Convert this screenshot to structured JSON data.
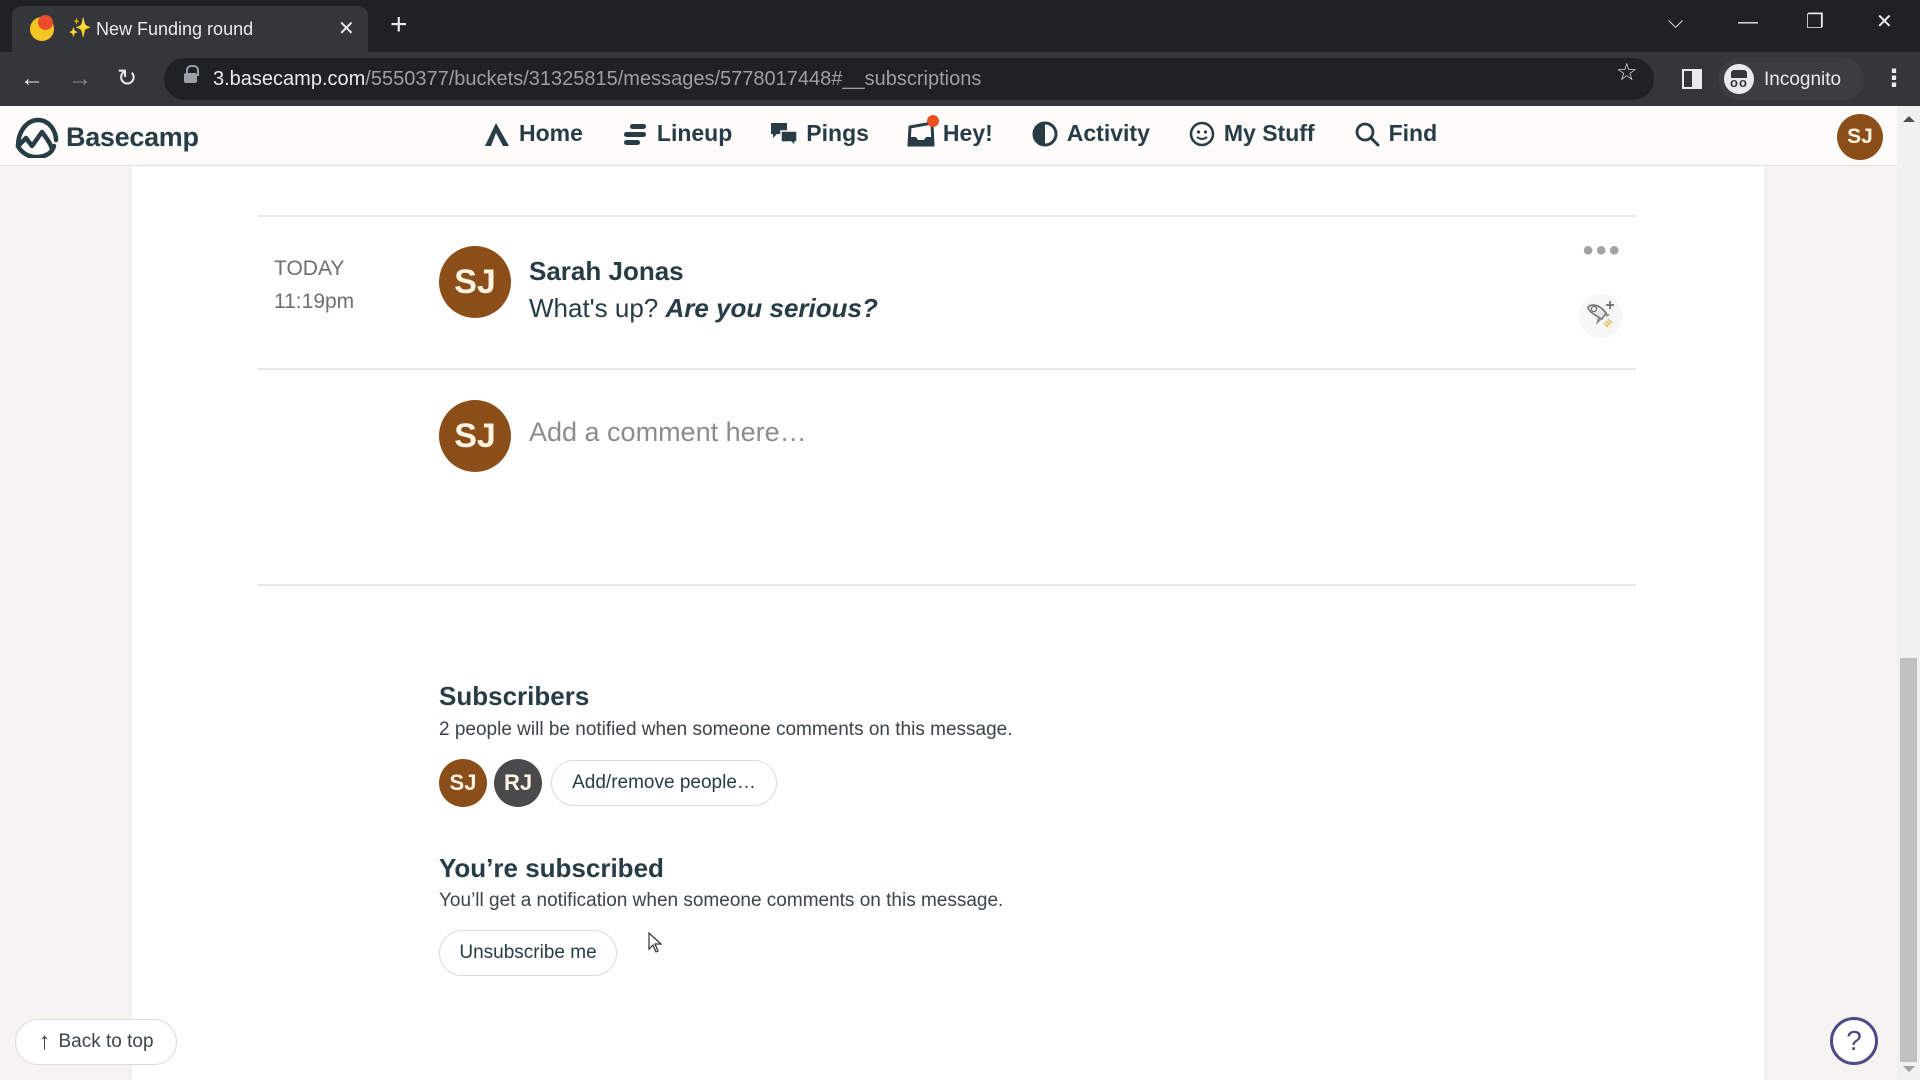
{
  "browser": {
    "tab": {
      "title": "New Funding round",
      "emoji": "✨"
    },
    "url": {
      "host": "3.basecamp.com",
      "path": "/5550377/buckets/31325815/messages/5778017448#__subscriptions"
    },
    "profile_label": "Incognito"
  },
  "app": {
    "brand": "Basecamp",
    "nav": [
      {
        "label": "Home",
        "icon": "home-icon"
      },
      {
        "label": "Lineup",
        "icon": "lineup-icon"
      },
      {
        "label": "Pings",
        "icon": "pings-icon"
      },
      {
        "label": "Hey!",
        "icon": "hey-inbox-icon",
        "has_notification": true
      },
      {
        "label": "Activity",
        "icon": "activity-icon"
      },
      {
        "label": "My Stuff",
        "icon": "smiley-icon"
      },
      {
        "label": "Find",
        "icon": "search-icon"
      }
    ],
    "user_initials": "SJ"
  },
  "comment": {
    "day": "TODAY",
    "time": "11:19pm",
    "author_initials": "SJ",
    "author": "Sarah Jonas",
    "text_plain": "What's up? ",
    "text_emphasis": "Are you serious?",
    "avatar_color": "#8c4e19"
  },
  "new_comment": {
    "avatar_initials": "SJ",
    "placeholder": "Add a comment here…"
  },
  "subscribers": {
    "heading": "Subscribers",
    "description": "2 people will be notified when someone comments on this message.",
    "people": [
      {
        "initials": "SJ",
        "color": "#8c4e19"
      },
      {
        "initials": "RJ",
        "color": "#4a4a4c"
      }
    ],
    "add_remove_label": "Add/remove people…"
  },
  "subscription": {
    "heading": "You’re subscribed",
    "description": "You’ll get a notification when someone comments on this message.",
    "unsubscribe_label": "Unsubscribe me"
  },
  "footer": {
    "back_to_top_label": "Back to top",
    "help_label": "?"
  }
}
